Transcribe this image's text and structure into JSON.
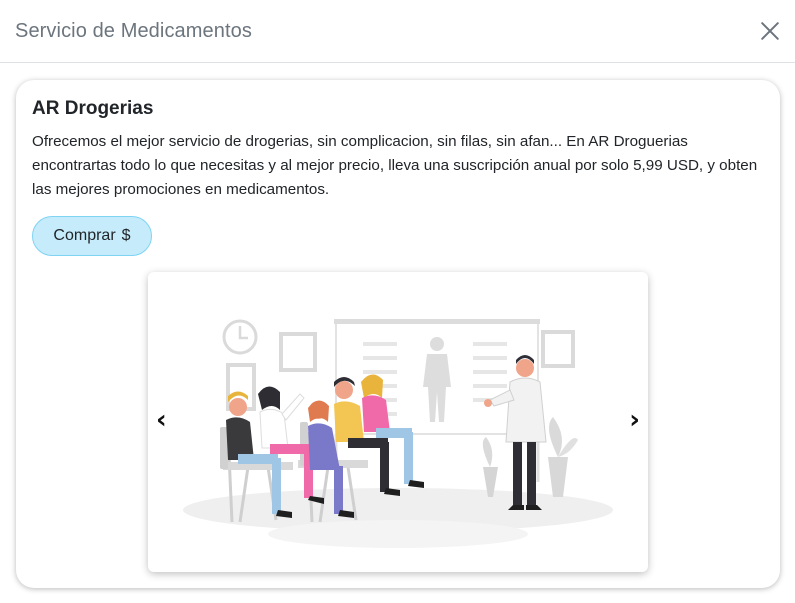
{
  "modal": {
    "title": "Servicio de Medicamentos"
  },
  "card": {
    "title": "AR Drogerias",
    "description": "Ofrecemos el mejor servicio de drogerias, sin complicacion, sin filas, sin afan... En AR Droguerias encontrartas todo lo que necesitas y al mejor precio, lleva una suscripción anual por solo 5,99 USD, y obten las mejores promociones en medicamentos.",
    "buy_label": "Comprar",
    "buy_icon": "$"
  },
  "carousel": {
    "prev_label": "‹",
    "next_label": "›",
    "slide_image": "doctor-presentation-illustration"
  },
  "colors": {
    "button_bg": "#c6ecfb",
    "button_border": "#7fd3f3",
    "title_gray": "#6c757d"
  }
}
